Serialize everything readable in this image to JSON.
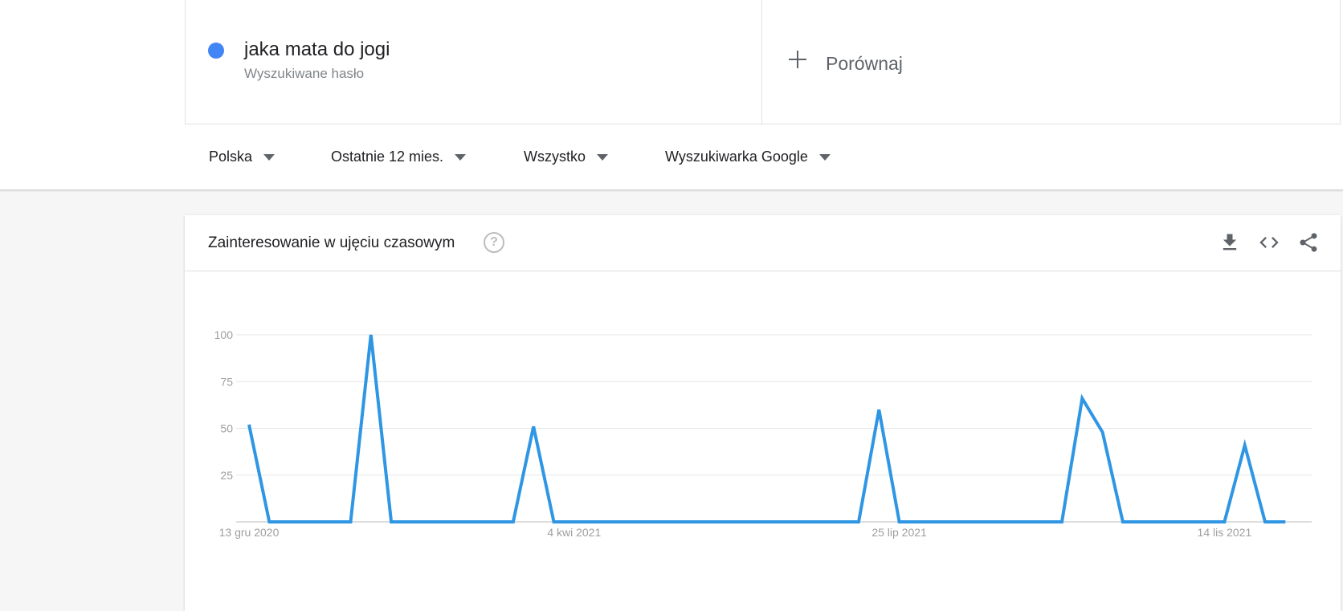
{
  "term": {
    "title": "jaka mata do jogi",
    "subtitle": "Wyszukiwane hasło",
    "dot_color": "#4285f4"
  },
  "compare": {
    "label": "Porównaj",
    "icon": "plus-icon"
  },
  "filters": [
    {
      "label": "Polska"
    },
    {
      "label": "Ostatnie 12 mies."
    },
    {
      "label": "Wszystko"
    },
    {
      "label": "Wyszukiwarka Google"
    }
  ],
  "card": {
    "title": "Zainteresowanie w ujęciu czasowym",
    "help_icon": "?",
    "actions": [
      "download-icon",
      "embed-icon",
      "share-icon"
    ]
  },
  "chart_data": {
    "type": "line",
    "title": "",
    "xlabel": "",
    "ylabel": "",
    "ylim": [
      0,
      100
    ],
    "yticks": [
      25,
      50,
      75,
      100
    ],
    "xtick_labels": [
      "13 gru 2020",
      "4 kwi 2021",
      "25 lip 2021",
      "14 lis 2021"
    ],
    "x": [
      "2020-12-13",
      "2020-12-20",
      "2020-12-27",
      "2021-01-03",
      "2021-01-10",
      "2021-01-17",
      "2021-01-24",
      "2021-01-31",
      "2021-02-07",
      "2021-02-14",
      "2021-02-21",
      "2021-02-28",
      "2021-03-07",
      "2021-03-14",
      "2021-03-21",
      "2021-03-28",
      "2021-04-04",
      "2021-04-11",
      "2021-04-18",
      "2021-04-25",
      "2021-05-02",
      "2021-05-09",
      "2021-05-16",
      "2021-05-23",
      "2021-05-30",
      "2021-06-06",
      "2021-06-13",
      "2021-06-20",
      "2021-06-27",
      "2021-07-04",
      "2021-07-11",
      "2021-07-18",
      "2021-07-25",
      "2021-08-01",
      "2021-08-08",
      "2021-08-15",
      "2021-08-22",
      "2021-08-29",
      "2021-09-05",
      "2021-09-12",
      "2021-09-19",
      "2021-09-26",
      "2021-10-03",
      "2021-10-10",
      "2021-10-17",
      "2021-10-24",
      "2021-10-31",
      "2021-11-07",
      "2021-11-14",
      "2021-11-21",
      "2021-11-28",
      "2021-12-05"
    ],
    "series": [
      {
        "color": "#2f96e4",
        "values": [
          52,
          0,
          0,
          0,
          0,
          0,
          100,
          0,
          0,
          0,
          0,
          0,
          0,
          0,
          51,
          0,
          0,
          0,
          0,
          0,
          0,
          0,
          0,
          0,
          0,
          0,
          0,
          0,
          0,
          0,
          0,
          60,
          0,
          0,
          0,
          0,
          0,
          0,
          0,
          0,
          0,
          66,
          48,
          0,
          0,
          0,
          0,
          0,
          0,
          41,
          0,
          0
        ]
      }
    ],
    "grid": true,
    "legend": "none"
  }
}
